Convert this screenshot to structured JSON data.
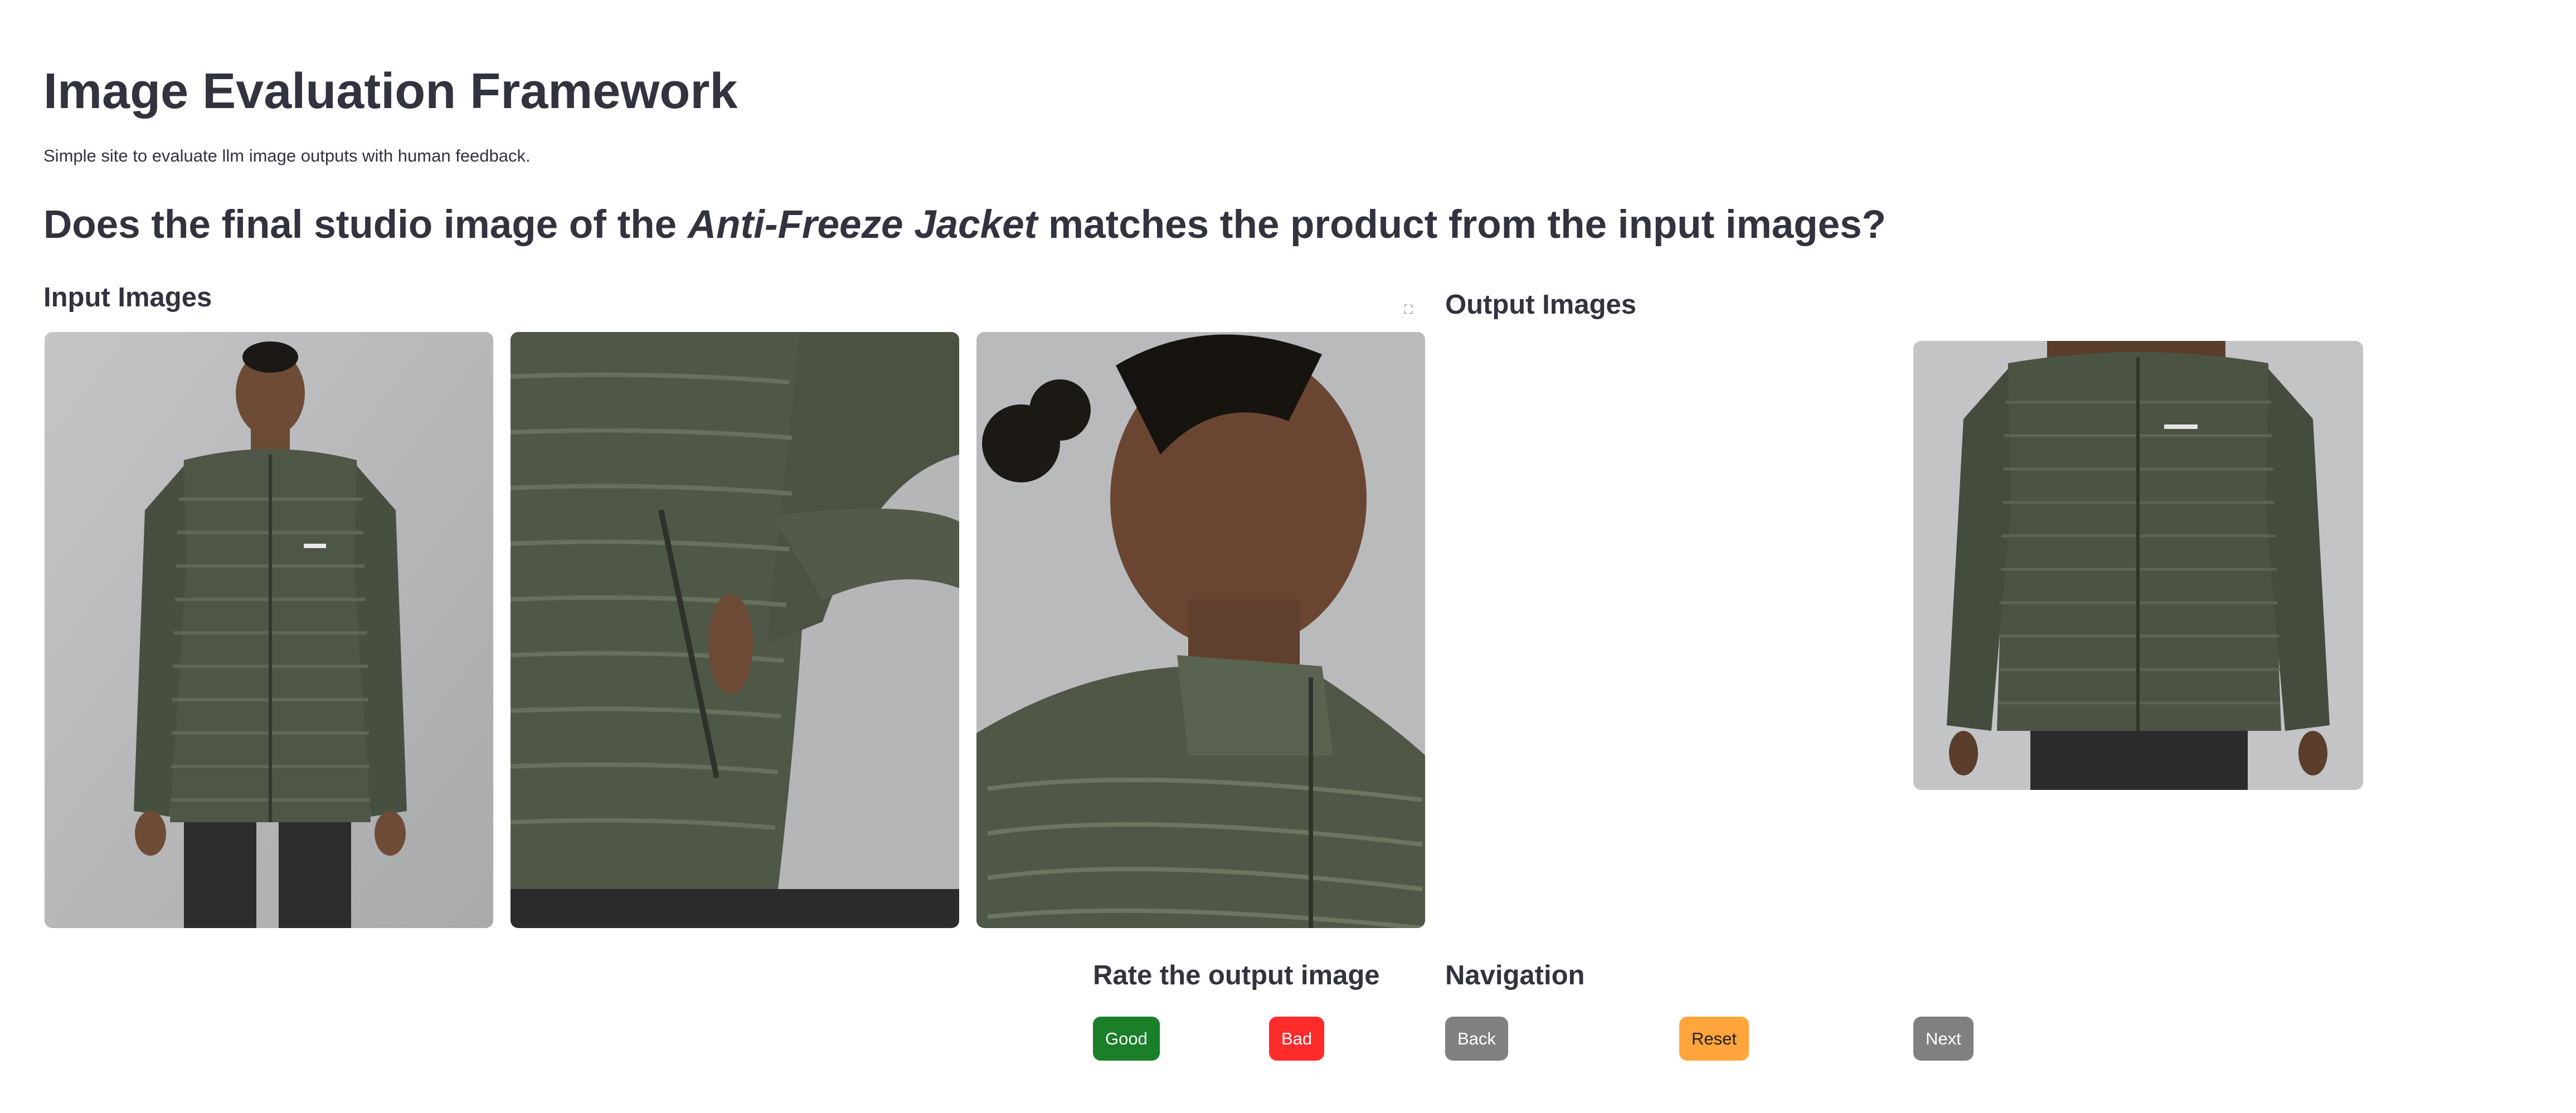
{
  "header": {
    "title": "Image Evaluation Framework",
    "subtitle": "Simple site to evaluate llm image outputs with human feedback."
  },
  "question": {
    "prefix": "Does the final studio image of the ",
    "product": "Anti-Freeze Jacket",
    "suffix": " matches the product from the input images?"
  },
  "input_section": {
    "heading": "Input Images"
  },
  "output_section": {
    "heading": "Output Images"
  },
  "rating": {
    "heading": "Rate the output image",
    "good_label": "Good",
    "bad_label": "Bad"
  },
  "navigation": {
    "heading": "Navigation",
    "back_label": "Back",
    "reset_label": "Reset",
    "next_label": "Next"
  },
  "colors": {
    "good": "#1a7f28",
    "bad": "#ff2b2b",
    "back": "#808080",
    "reset": "#ffa53b",
    "next": "#808080",
    "jacket": "#4e5645",
    "background_studio": "#b7b8ba",
    "text": "#31333f"
  },
  "icons": {
    "fullscreen": "fullscreen-icon"
  }
}
